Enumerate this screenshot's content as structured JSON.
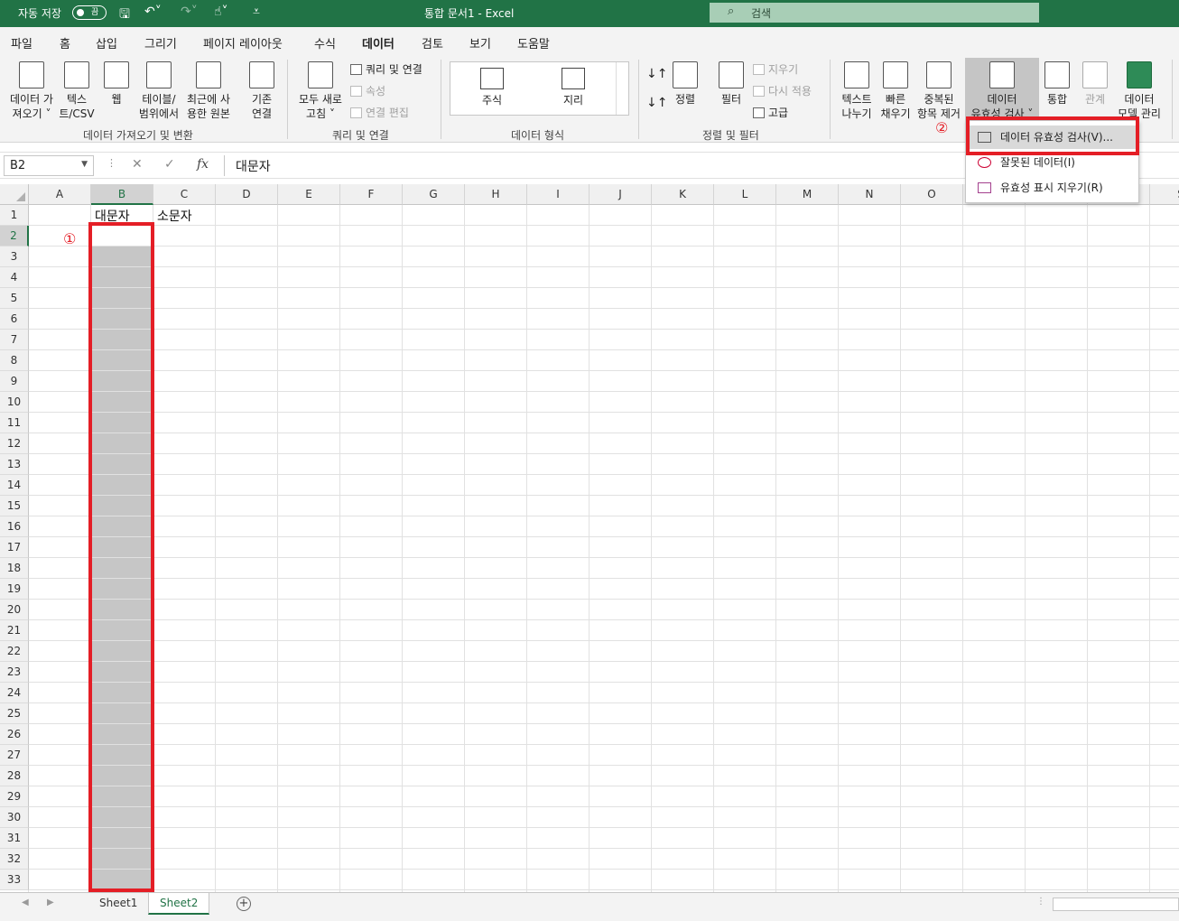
{
  "titlebar": {
    "autosave_label": "자동 저장",
    "autosave_state": "끔",
    "doc_title": "통합 문서1  -  Excel",
    "search_placeholder": "검색"
  },
  "menu": {
    "tabs": [
      "파일",
      "홈",
      "삽입",
      "그리기",
      "페이지 레이아웃",
      "수식",
      "데이터",
      "검토",
      "보기",
      "도움말"
    ],
    "active_tab": "데이터"
  },
  "ribbon": {
    "get_data": {
      "l1": "데이터 가",
      "l2": "져오기 ˅"
    },
    "text_csv": {
      "l1": "텍스",
      "l2": "트/CSV"
    },
    "web": {
      "l1": "웹"
    },
    "from_table": {
      "l1": "테이블/",
      "l2": "범위에서"
    },
    "recent_sources": {
      "l1": "최근에 사",
      "l2": "용한 원본"
    },
    "existing_conn": {
      "l1": "기존",
      "l2": "연결"
    },
    "refresh_all": {
      "l1": "모두 새로",
      "l2": "고침 ˅"
    },
    "queries_conn": "쿼리 및 연결",
    "properties": "속성",
    "edit_links": "연결 편집",
    "stocks": "주식",
    "geography": "지리",
    "sort": "정렬",
    "filter": "필터",
    "clear": "지우기",
    "reapply": "다시 적용",
    "advanced": "고급",
    "text_to_columns": {
      "l1": "텍스트",
      "l2": "나누기"
    },
    "flash_fill": {
      "l1": "빠른",
      "l2": "채우기"
    },
    "remove_dup": {
      "l1": "중복된",
      "l2": "항목 제거"
    },
    "data_validation": {
      "l1": "데이터",
      "l2": "유효성 검사 ˅"
    },
    "consolidate": "통합",
    "relationships": "관계",
    "data_model": {
      "l1": "데이터",
      "l2": "모델 관리"
    },
    "group_labels": {
      "get_transform": "데이터 가져오기 및 변환",
      "queries": "쿼리 및 연결",
      "data_types": "데이터 형식",
      "sort_filter": "정렬 및 필터"
    }
  },
  "formula_bar": {
    "name_box": "B2",
    "cancel": "✕",
    "enter": "✓",
    "fx": "fx",
    "content": "대문자"
  },
  "grid": {
    "columns": [
      "A",
      "B",
      "C",
      "D",
      "E",
      "F",
      "G",
      "H",
      "I",
      "J",
      "K",
      "L",
      "M",
      "N",
      "O",
      "P",
      "Q",
      "R",
      "S"
    ],
    "rows": [
      "1",
      "2",
      "3",
      "4",
      "5",
      "6",
      "7",
      "8",
      "9",
      "10",
      "11",
      "12",
      "13",
      "14",
      "15",
      "16",
      "17",
      "18",
      "19",
      "20",
      "21",
      "22",
      "23",
      "24",
      "25",
      "26",
      "27",
      "28",
      "29",
      "30",
      "31",
      "32",
      "33"
    ],
    "selected_column": "B",
    "cells": {
      "B1": "대문자",
      "C1": "소문자"
    }
  },
  "annotations": {
    "step1": "①",
    "step2": "②"
  },
  "dropdown": {
    "items": [
      "데이터 유효성 검사(V)...",
      "잘못된 데이터(I)",
      "유효성 표시 지우기(R)"
    ]
  },
  "sheets": {
    "tabs": [
      "Sheet1",
      "Sheet2"
    ],
    "active": "Sheet2",
    "add_label": "+"
  },
  "colors": {
    "excel_green": "#217346",
    "highlight_red": "#e41e26",
    "selection_gray": "#c6c6c6"
  }
}
